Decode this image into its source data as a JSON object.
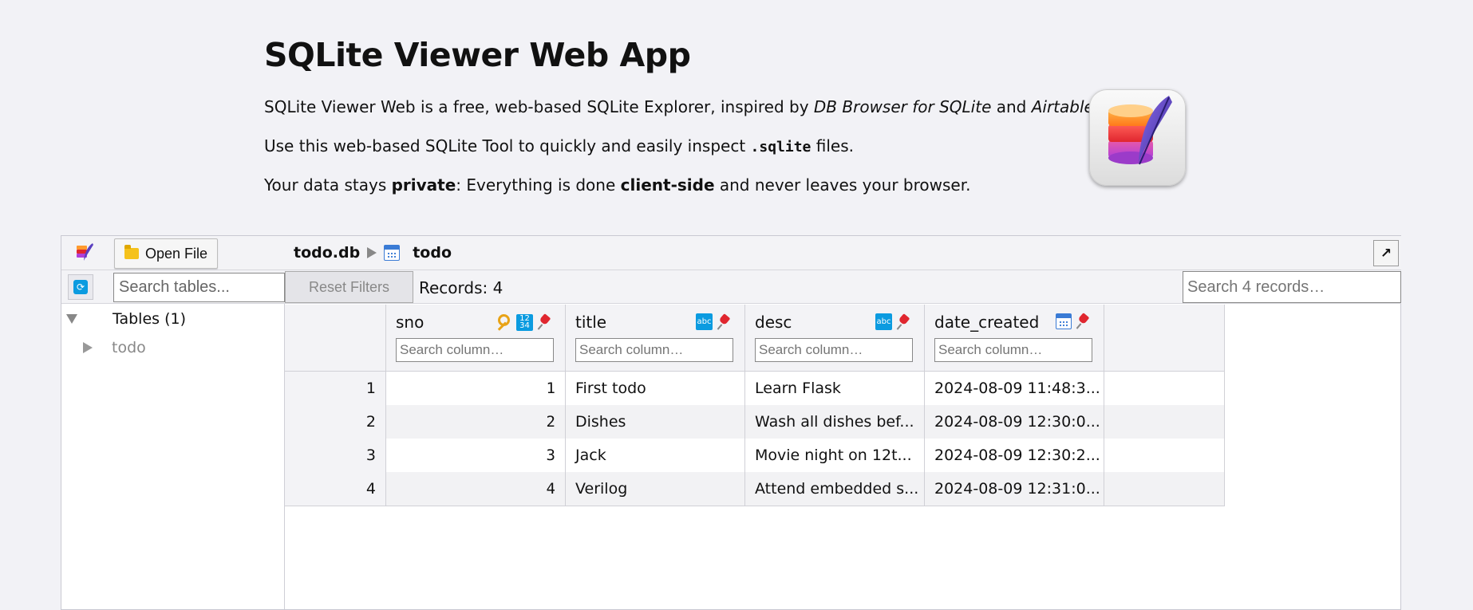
{
  "intro": {
    "title": "SQLite Viewer Web App",
    "p1_a": "SQLite Viewer Web is a free, web-based SQLite Explorer, inspired by ",
    "p1_b": "DB Browser for SQLite",
    "p1_c": " and ",
    "p1_d": "Airtable",
    "p1_e": ".",
    "p2_a": "Use this web-based SQLite Tool to quickly and easily inspect ",
    "p2_code": ".sqlite",
    "p2_b": " files.",
    "p3_a": "Your data stays ",
    "p3_b": "private",
    "p3_c": ": Everything is done ",
    "p3_d": "client-side",
    "p3_e": " and never leaves your browser."
  },
  "toolbar": {
    "open_file_label": "Open File",
    "search_tables_placeholder": "Search tables...",
    "reset_filters_label": "Reset Filters",
    "records_label": "Records: 4",
    "search_records_placeholder": "Search 4 records…",
    "expand_label": "↗"
  },
  "breadcrumb": {
    "db": "todo.db",
    "table": "todo"
  },
  "tree": {
    "group_label": "Tables (1)",
    "items": [
      {
        "label": "todo"
      }
    ]
  },
  "grid": {
    "columns": [
      {
        "name": "sno",
        "type_icon": "integer-icon",
        "placeholder": "Search column…"
      },
      {
        "name": "title",
        "type_icon": "text-icon",
        "placeholder": "Search column…"
      },
      {
        "name": "desc",
        "type_icon": "text-icon",
        "placeholder": "Search column…"
      },
      {
        "name": "date_created",
        "type_icon": "calendar-icon",
        "placeholder": "Search column…"
      }
    ],
    "rows": [
      {
        "idx": "1",
        "sno": "1",
        "title": "First todo",
        "desc": "Learn Flask",
        "date_created": "2024-08-09 11:48:3..."
      },
      {
        "idx": "2",
        "sno": "2",
        "title": "Dishes",
        "desc": "Wash all dishes bef...",
        "date_created": "2024-08-09 12:30:0..."
      },
      {
        "idx": "3",
        "sno": "3",
        "title": "Jack",
        "desc": "Movie night on 12t...",
        "date_created": "2024-08-09 12:30:2..."
      },
      {
        "idx": "4",
        "sno": "4",
        "title": "Verilog",
        "desc": "Attend embedded s...",
        "date_created": "2024-08-09 12:31:0..."
      }
    ]
  },
  "colors": {
    "accent": "#0b9be0",
    "pin": "#e0262f",
    "key": "#e8a317"
  }
}
